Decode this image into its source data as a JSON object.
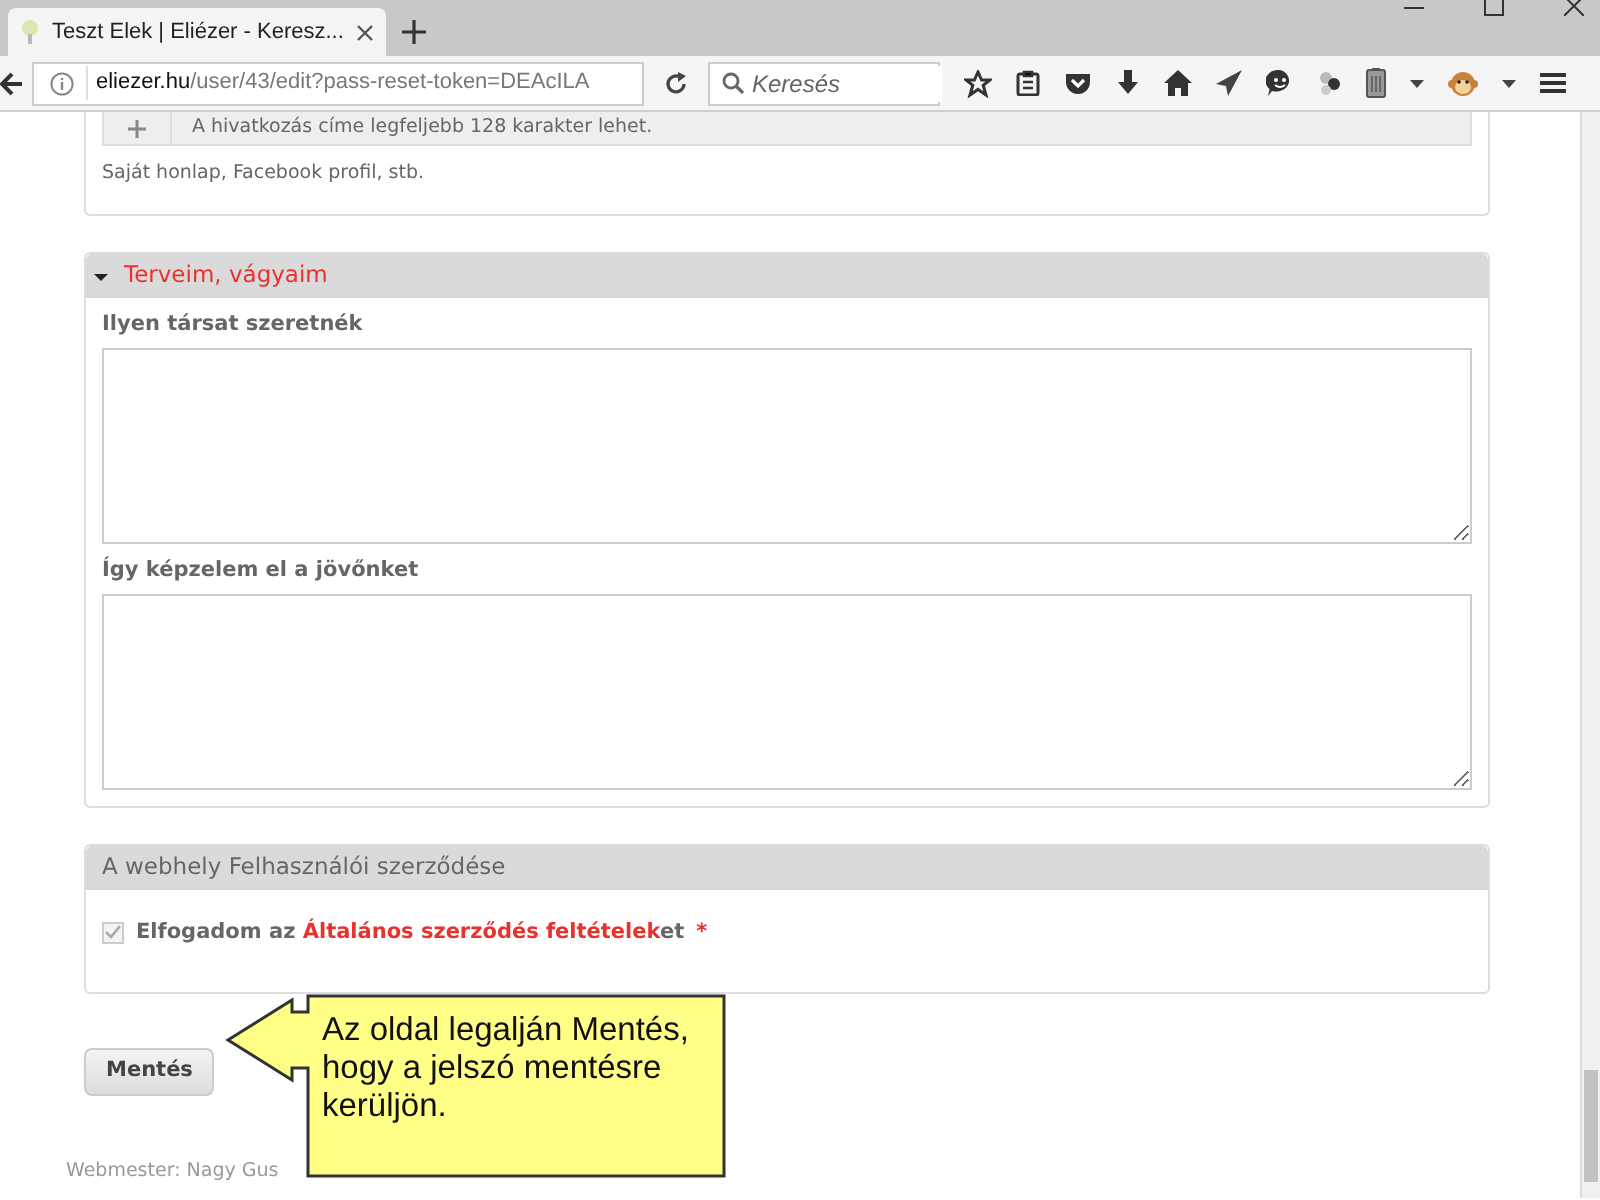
{
  "browser": {
    "tab_title": "Teszt Elek | Eliézer - Keresz...",
    "url_host": "eliezer.hu",
    "url_path": "/user/43/edit?pass-reset-token=DEAcILA",
    "search": {
      "placeholder": "Keresés"
    }
  },
  "link_field": {
    "hint": "A hivatkozás címe legfeljebb 128 karakter lehet.",
    "description": "Saját honlap, Facebook profil, stb."
  },
  "sections": [
    {
      "title": "Terveim, vágyaim",
      "expanded": true,
      "fields": [
        {
          "label": "Ilyen társat szeretnék"
        },
        {
          "label": "Így képzelem el a jövőnket"
        }
      ]
    }
  ],
  "agreement": {
    "title": "A webhely Felhasználói szerződése",
    "checked": true,
    "text_before": "Elfogadom az ",
    "link": "Általános szerződés feltételek",
    "text_after": "et",
    "required_mark": "*"
  },
  "save_button": "Mentés",
  "footer": "Webmester: Nagy Gus",
  "callout": "Az oldal legalján Mentés, hogy a jelszó mentésre kerüljön."
}
